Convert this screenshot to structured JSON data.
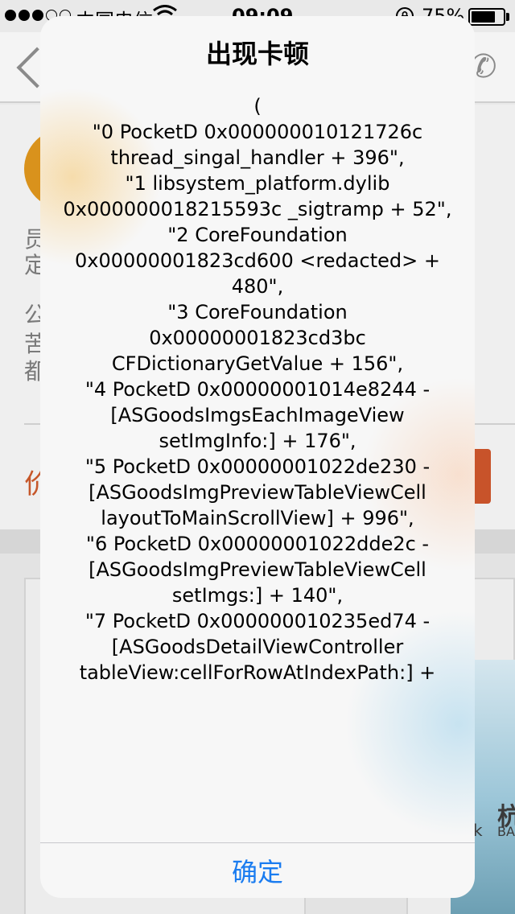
{
  "status_bar": {
    "carrier": "中国电信",
    "time": "09:09",
    "battery_percent": "75%",
    "battery_level": 0.75,
    "signal_bars": 5,
    "signal_filled": 3,
    "icons": [
      "signal-dots-icon",
      "wifi-icon",
      "orientation-lock-icon",
      "battery-icon"
    ]
  },
  "background": {
    "nav_icons": [
      "back-arrow-icon",
      "phone-icon"
    ],
    "partial_chars": [
      "员",
      "定",
      "公",
      "苦",
      "都"
    ],
    "price_char": "价",
    "fragment_k": "k",
    "fragment_hang": "杭",
    "fragment_ba": "BA",
    "colors": {
      "avatar": "#d9921c",
      "price": "#c6572a",
      "button": "#c8532a"
    }
  },
  "alert": {
    "title": "出现卡顿",
    "message": "(\n\"0   PocketD 0x000000010121726c thread_singal_handler + 396\",\n\"1   libsystem_platform.dylib 0x000000018215593c _sigtramp + 52\",\n\"2   CoreFoundation 0x00000001823cd600 <redacted> + 480\",\n\"3   CoreFoundation 0x00000001823cd3bc CFDictionaryGetValue + 156\",\n\"4   PocketD 0x00000001014e8244 -[ASGoodsImgsEachImageView setImgInfo:] + 176\",\n\"5   PocketD 0x00000001022de230 -[ASGoodsImgPreviewTableViewCell layoutToMainScrollView] + 996\",\n\"6   PocketD 0x00000001022dde2c -[ASGoodsImgPreviewTableViewCell setImgs:] + 140\",\n\"7   PocketD 0x000000010235ed74 -[ASGoodsDetailViewController tableView:cellForRowAtIndexPath:] +",
    "confirm_button": "确定",
    "colors": {
      "button_text": "#1a7cf0",
      "background": "#f7f7f7"
    }
  }
}
